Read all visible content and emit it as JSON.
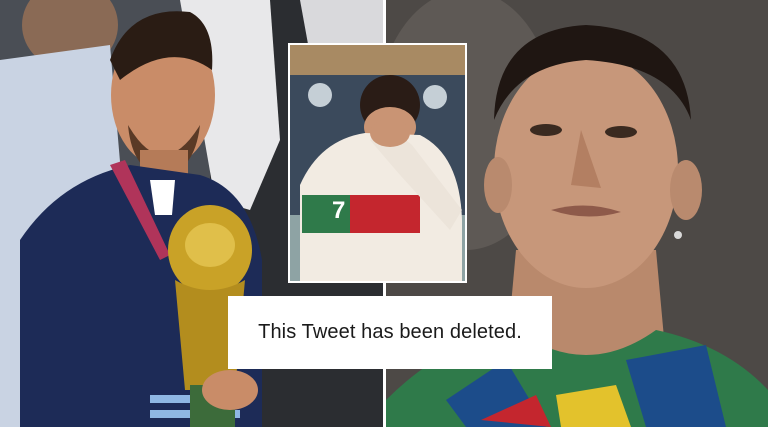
{
  "banner": {
    "text": "This Tweet has been deleted."
  },
  "inset": {
    "shirt_number": "7"
  },
  "colors": {
    "banner_bg": "#ffffff",
    "banner_text": "#1a1a1a",
    "divider": "#ffffff",
    "trophy_gold": "#c9a227",
    "jacket_navy": "#1d2b57",
    "portugal_red": "#c4262e",
    "portugal_green": "#2f7a4a"
  }
}
